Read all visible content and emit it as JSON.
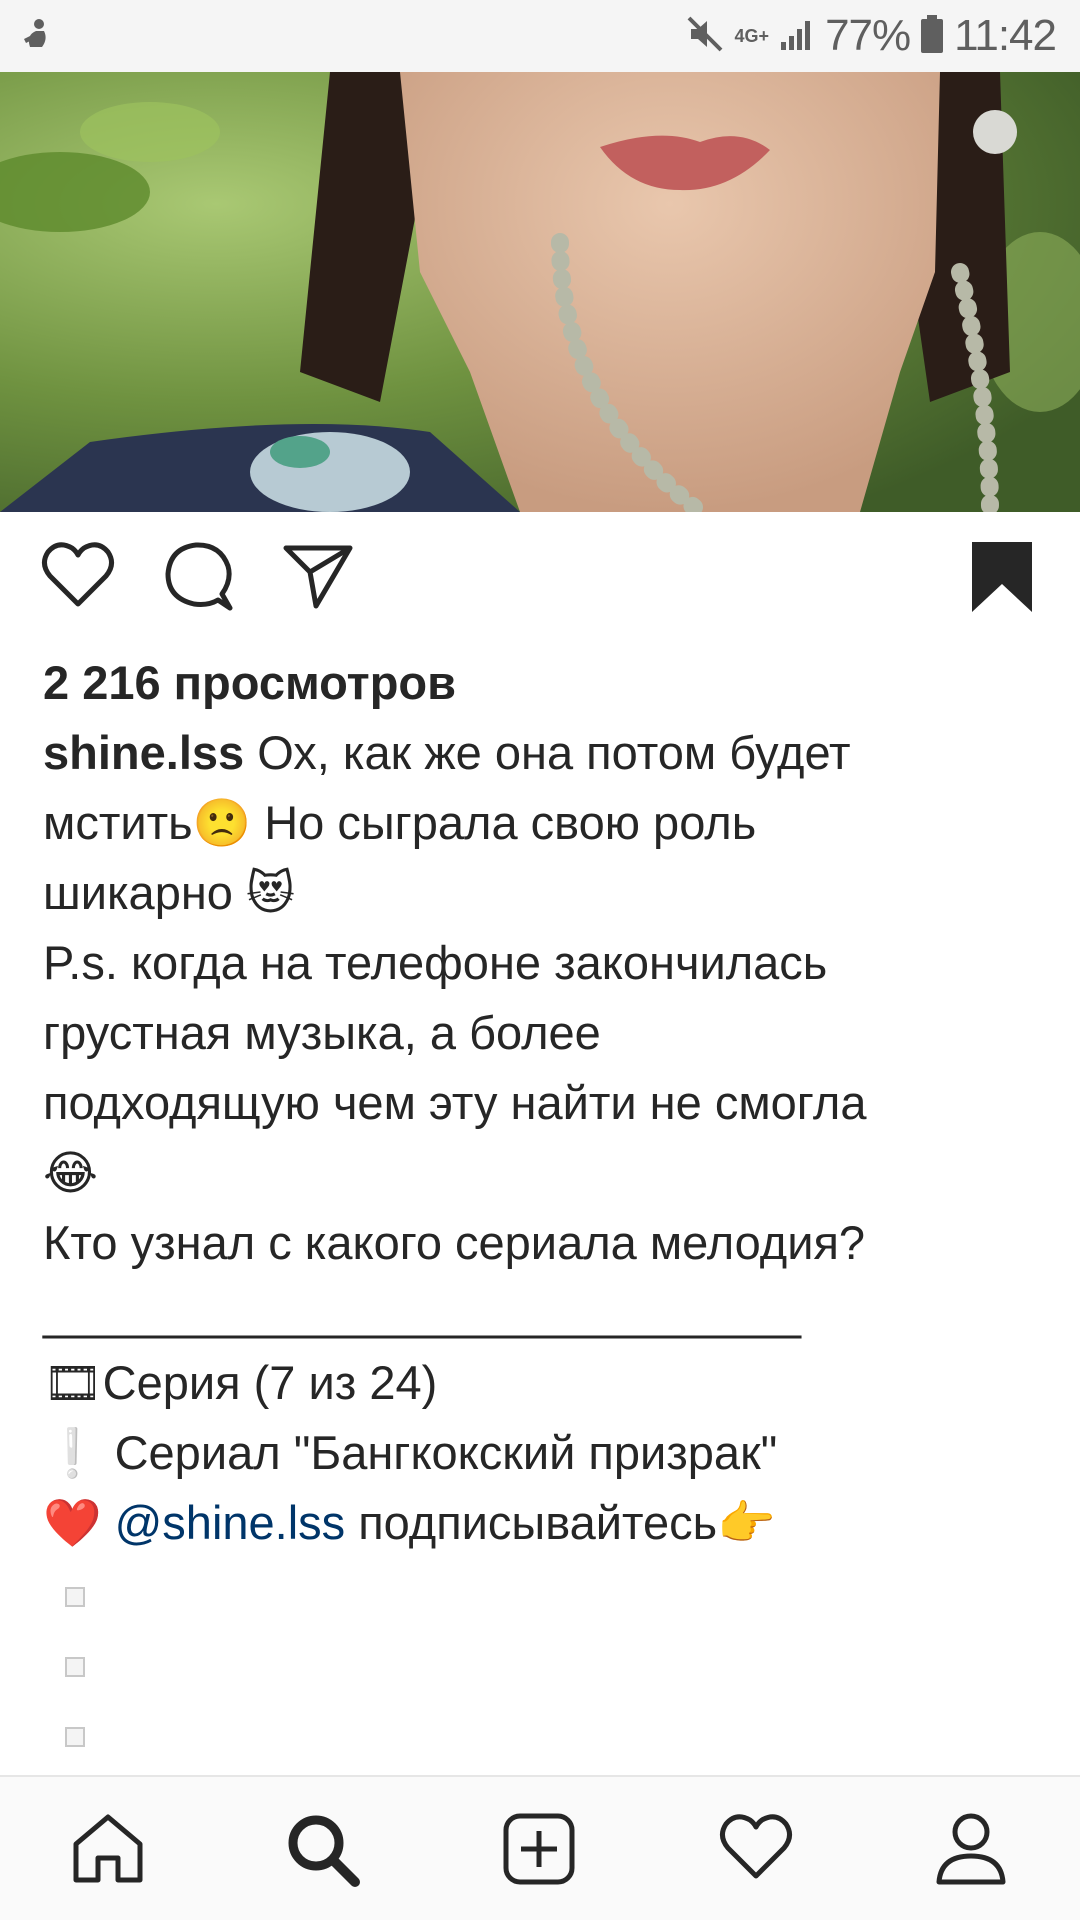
{
  "status_bar": {
    "network_type": "4G+",
    "battery_percent": "77%",
    "time": "11:42",
    "icons": [
      "notification-app-icon",
      "mute-icon",
      "signal-icon",
      "battery-icon"
    ]
  },
  "post": {
    "views_label": "2 216 просмотров",
    "username": "shine.lss",
    "caption_lines": [
      "Ох, как же она потом будет",
      "мстить",
      "🙁",
      "Но сыграла свою роль",
      "шикарно",
      "😻",
      "P.s. когда на телефоне закончилась",
      "грустная музыка, а более",
      "подходящую чем эту найти не смогла",
      "😂",
      "Кто узнал с какого сериала мелодия?",
      "_____________________________",
      "🎞",
      "Серия (7 из 24)",
      "❕",
      "Сериал \"Бангкокский призрак\"",
      "❤️",
      "@shine.lss",
      "подписывайтесь",
      "👉"
    ],
    "actions": [
      "like-icon",
      "comment-icon",
      "share-icon",
      "bookmark-icon"
    ],
    "colors": {
      "text": "#262626",
      "mention": "#003569",
      "heart": "#ed2d3a"
    }
  },
  "bottom_nav": {
    "items": [
      "home-icon",
      "search-icon",
      "new-post-icon",
      "activity-icon",
      "profile-icon"
    ]
  }
}
